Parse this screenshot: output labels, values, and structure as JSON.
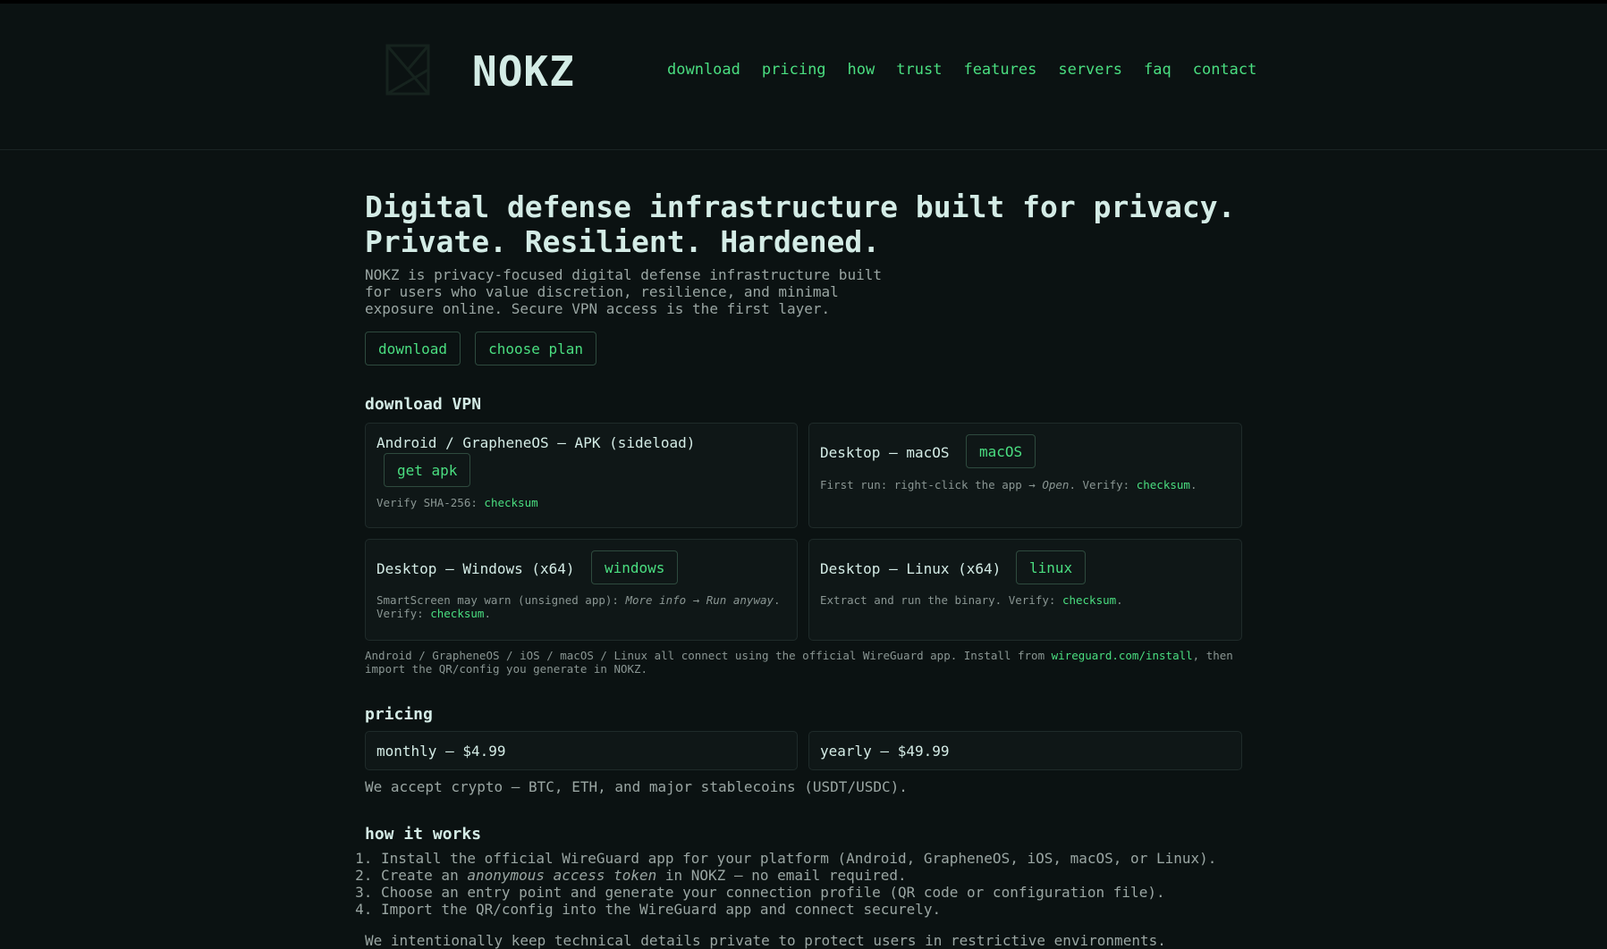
{
  "brand": {
    "name": "NOKZ"
  },
  "nav": [
    {
      "label": "download"
    },
    {
      "label": "pricing"
    },
    {
      "label": "how"
    },
    {
      "label": "trust"
    },
    {
      "label": "features"
    },
    {
      "label": "servers"
    },
    {
      "label": "faq"
    },
    {
      "label": "contact"
    }
  ],
  "hero": {
    "title_line1": "Digital defense infrastructure built for privacy.",
    "title_line2": "Private. Resilient. Hardened.",
    "intro": "NOKZ is privacy-focused digital defense infrastructure built for users who value discretion, resilience, and minimal exposure online. Secure VPN access is the first layer.",
    "download_btn": "download",
    "plan_btn": "choose plan"
  },
  "download": {
    "title": "download VPN",
    "android": {
      "title": "Android / GrapheneOS — APK (sideload)",
      "button": "get apk",
      "note_prefix": "Verify SHA-256: ",
      "link": "checksum"
    },
    "macos": {
      "title": "Desktop — macOS",
      "button": "macOS",
      "note_prefix": "First run: right-click the app → ",
      "note_em": "Open",
      "note_mid": ". Verify: ",
      "link": "checksum",
      "note_suffix": "."
    },
    "windows": {
      "title": "Desktop — Windows (x64)",
      "button": "windows",
      "note_prefix": "SmartScreen may warn (unsigned app): ",
      "note_em": "More info → Run anyway",
      "note_mid": ".",
      "note_line2": "Verify: ",
      "link": "checksum",
      "note_suffix": "."
    },
    "linux": {
      "title": "Desktop — Linux (x64)",
      "button": "linux",
      "note_prefix": "Extract and run the binary. Verify: ",
      "link": "checksum",
      "note_suffix": "."
    },
    "footnote_prefix": "Android / GrapheneOS / iOS / macOS / Linux all connect using the official WireGuard app. Install from ",
    "footnote_link": "wireguard.com/install",
    "footnote_suffix": ", then import the QR/config you generate in NOKZ."
  },
  "pricing": {
    "title": "pricing",
    "monthly": "monthly — $4.99",
    "yearly": "yearly — $49.99",
    "crypto": "We accept crypto — BTC, ETH, and major stablecoins (USDT/USDC)."
  },
  "how": {
    "title": "how it works",
    "step1": "Install the official WireGuard app for your platform (Android, GrapheneOS, iOS, macOS, or Linux).",
    "step2_prefix": "Create an ",
    "step2_em": "anonymous access token",
    "step2_suffix": " in NOKZ — no email required.",
    "step3": "Choose an entry point and generate your connection profile (QR code or configuration file).",
    "step4": "Import the QR/config into the WireGuard app and connect securely.",
    "trailing": "We intentionally keep technical details private to protect users in restrictive environments."
  },
  "colors": {
    "background": "#0b1212",
    "accent": "#4ade80",
    "heading": "#d4ece6",
    "text": "#9aa6a3",
    "card": "#0f1717",
    "border": "#1f2b2a"
  }
}
